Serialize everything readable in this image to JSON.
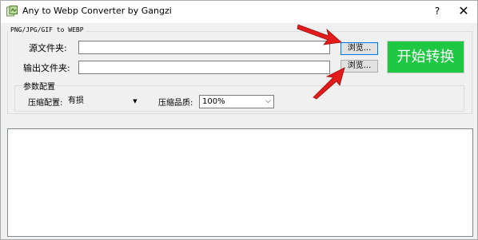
{
  "window": {
    "title": "Any to Webp Converter by Gangzi",
    "help_label": "?",
    "close_label": "✕"
  },
  "main_group": {
    "title": "PNG/JPG/GIF to WEBP",
    "source_label": "源文件夹:",
    "source_value": "",
    "output_label": "输出文件夹:",
    "output_value": "",
    "browse_source_label": "浏览...",
    "browse_output_label": "浏览...",
    "start_label": "开始转换"
  },
  "params_group": {
    "title": "参数配置",
    "compression_label": "压缩配置:",
    "compression_value": "有损",
    "quality_label": "压缩品质:",
    "quality_value": "100%"
  },
  "log": {
    "content": ""
  },
  "colors": {
    "start_button": "#1fc843",
    "annotation_arrow": "#e21b1b"
  },
  "icons": {
    "app": "webp-app-icon",
    "annotation": "red-arrow-icon"
  }
}
